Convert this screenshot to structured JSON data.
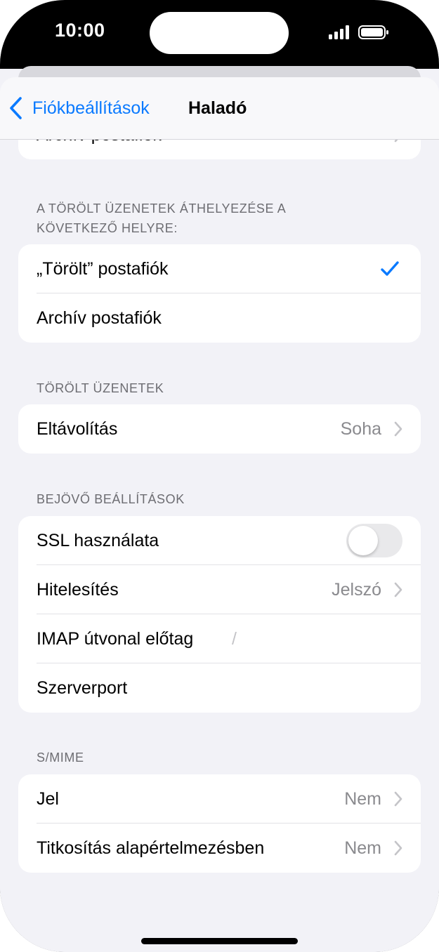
{
  "status_bar": {
    "time": "10:00"
  },
  "navbar": {
    "back_label": "Fiókbeállítások",
    "title": "Haladó"
  },
  "partial_row": {
    "label": "Archív postafiók"
  },
  "section_move": {
    "header_line1": "A TÖRÖLT ÜZENETEK ÁTHELYEZÉSE A",
    "header_line2": "KÖVETKEZŐ HELYRE:",
    "rows": [
      {
        "label": "„Törölt” postafiók",
        "selected": true
      },
      {
        "label": "Archív postafiók",
        "selected": false
      }
    ]
  },
  "section_deleted": {
    "header": "TÖRÖLT ÜZENETEK",
    "rows": [
      {
        "label": "Eltávolítás",
        "value": "Soha"
      }
    ]
  },
  "section_incoming": {
    "header": "BEJÖVŐ BEÁLLÍTÁSOK",
    "ssl_label": "SSL használata",
    "ssl_enabled": false,
    "auth_label": "Hitelesítés",
    "auth_value": "Jelszó",
    "imap_label": "IMAP útvonal előtag",
    "imap_value": "/",
    "port_label": "Szerverport"
  },
  "section_smime": {
    "header": "S/MIME",
    "rows": [
      {
        "label": "Jel",
        "value": "Nem"
      },
      {
        "label": "Titkosítás alapértelmezésben",
        "value": "Nem"
      }
    ]
  },
  "colors": {
    "accent": "#0a7aff",
    "background": "#f2f2f7",
    "secondary_text": "#8a8a8e",
    "header_text": "#6d6d72"
  },
  "icons": {
    "back": "chevron-left-icon",
    "disclosure": "chevron-right-icon",
    "selected": "checkmark-icon"
  }
}
